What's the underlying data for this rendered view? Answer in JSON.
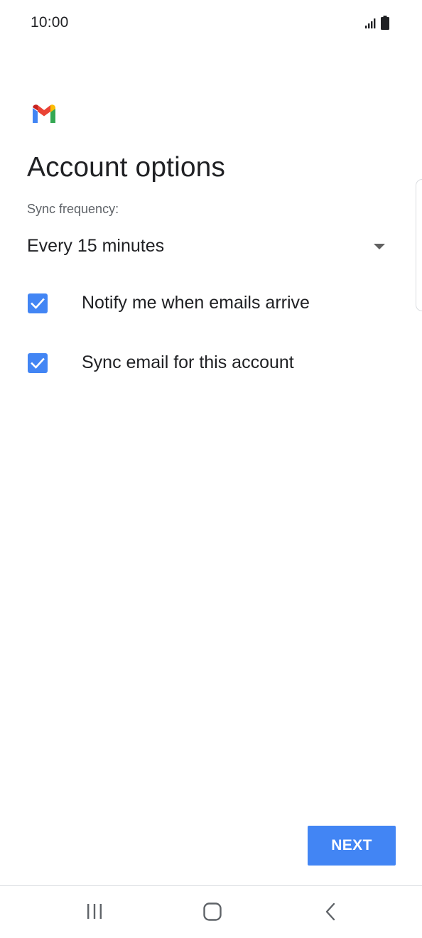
{
  "status_bar": {
    "time": "10:00",
    "icons": [
      "signal-icon",
      "battery-icon"
    ]
  },
  "app": {
    "logo": "gmail-logo-icon"
  },
  "page": {
    "title": "Account options"
  },
  "sync": {
    "label": "Sync frequency:",
    "selected": "Every 15 minutes"
  },
  "options": [
    {
      "label": "Notify me when emails arrive",
      "checked": true
    },
    {
      "label": "Sync email for this account",
      "checked": true
    }
  ],
  "actions": {
    "next_label": "NEXT"
  },
  "nav": {
    "items": [
      "recents-icon",
      "home-icon",
      "back-icon"
    ]
  },
  "colors": {
    "accent": "#4285f4",
    "text": "#202124",
    "secondary_text": "#5f6368"
  }
}
